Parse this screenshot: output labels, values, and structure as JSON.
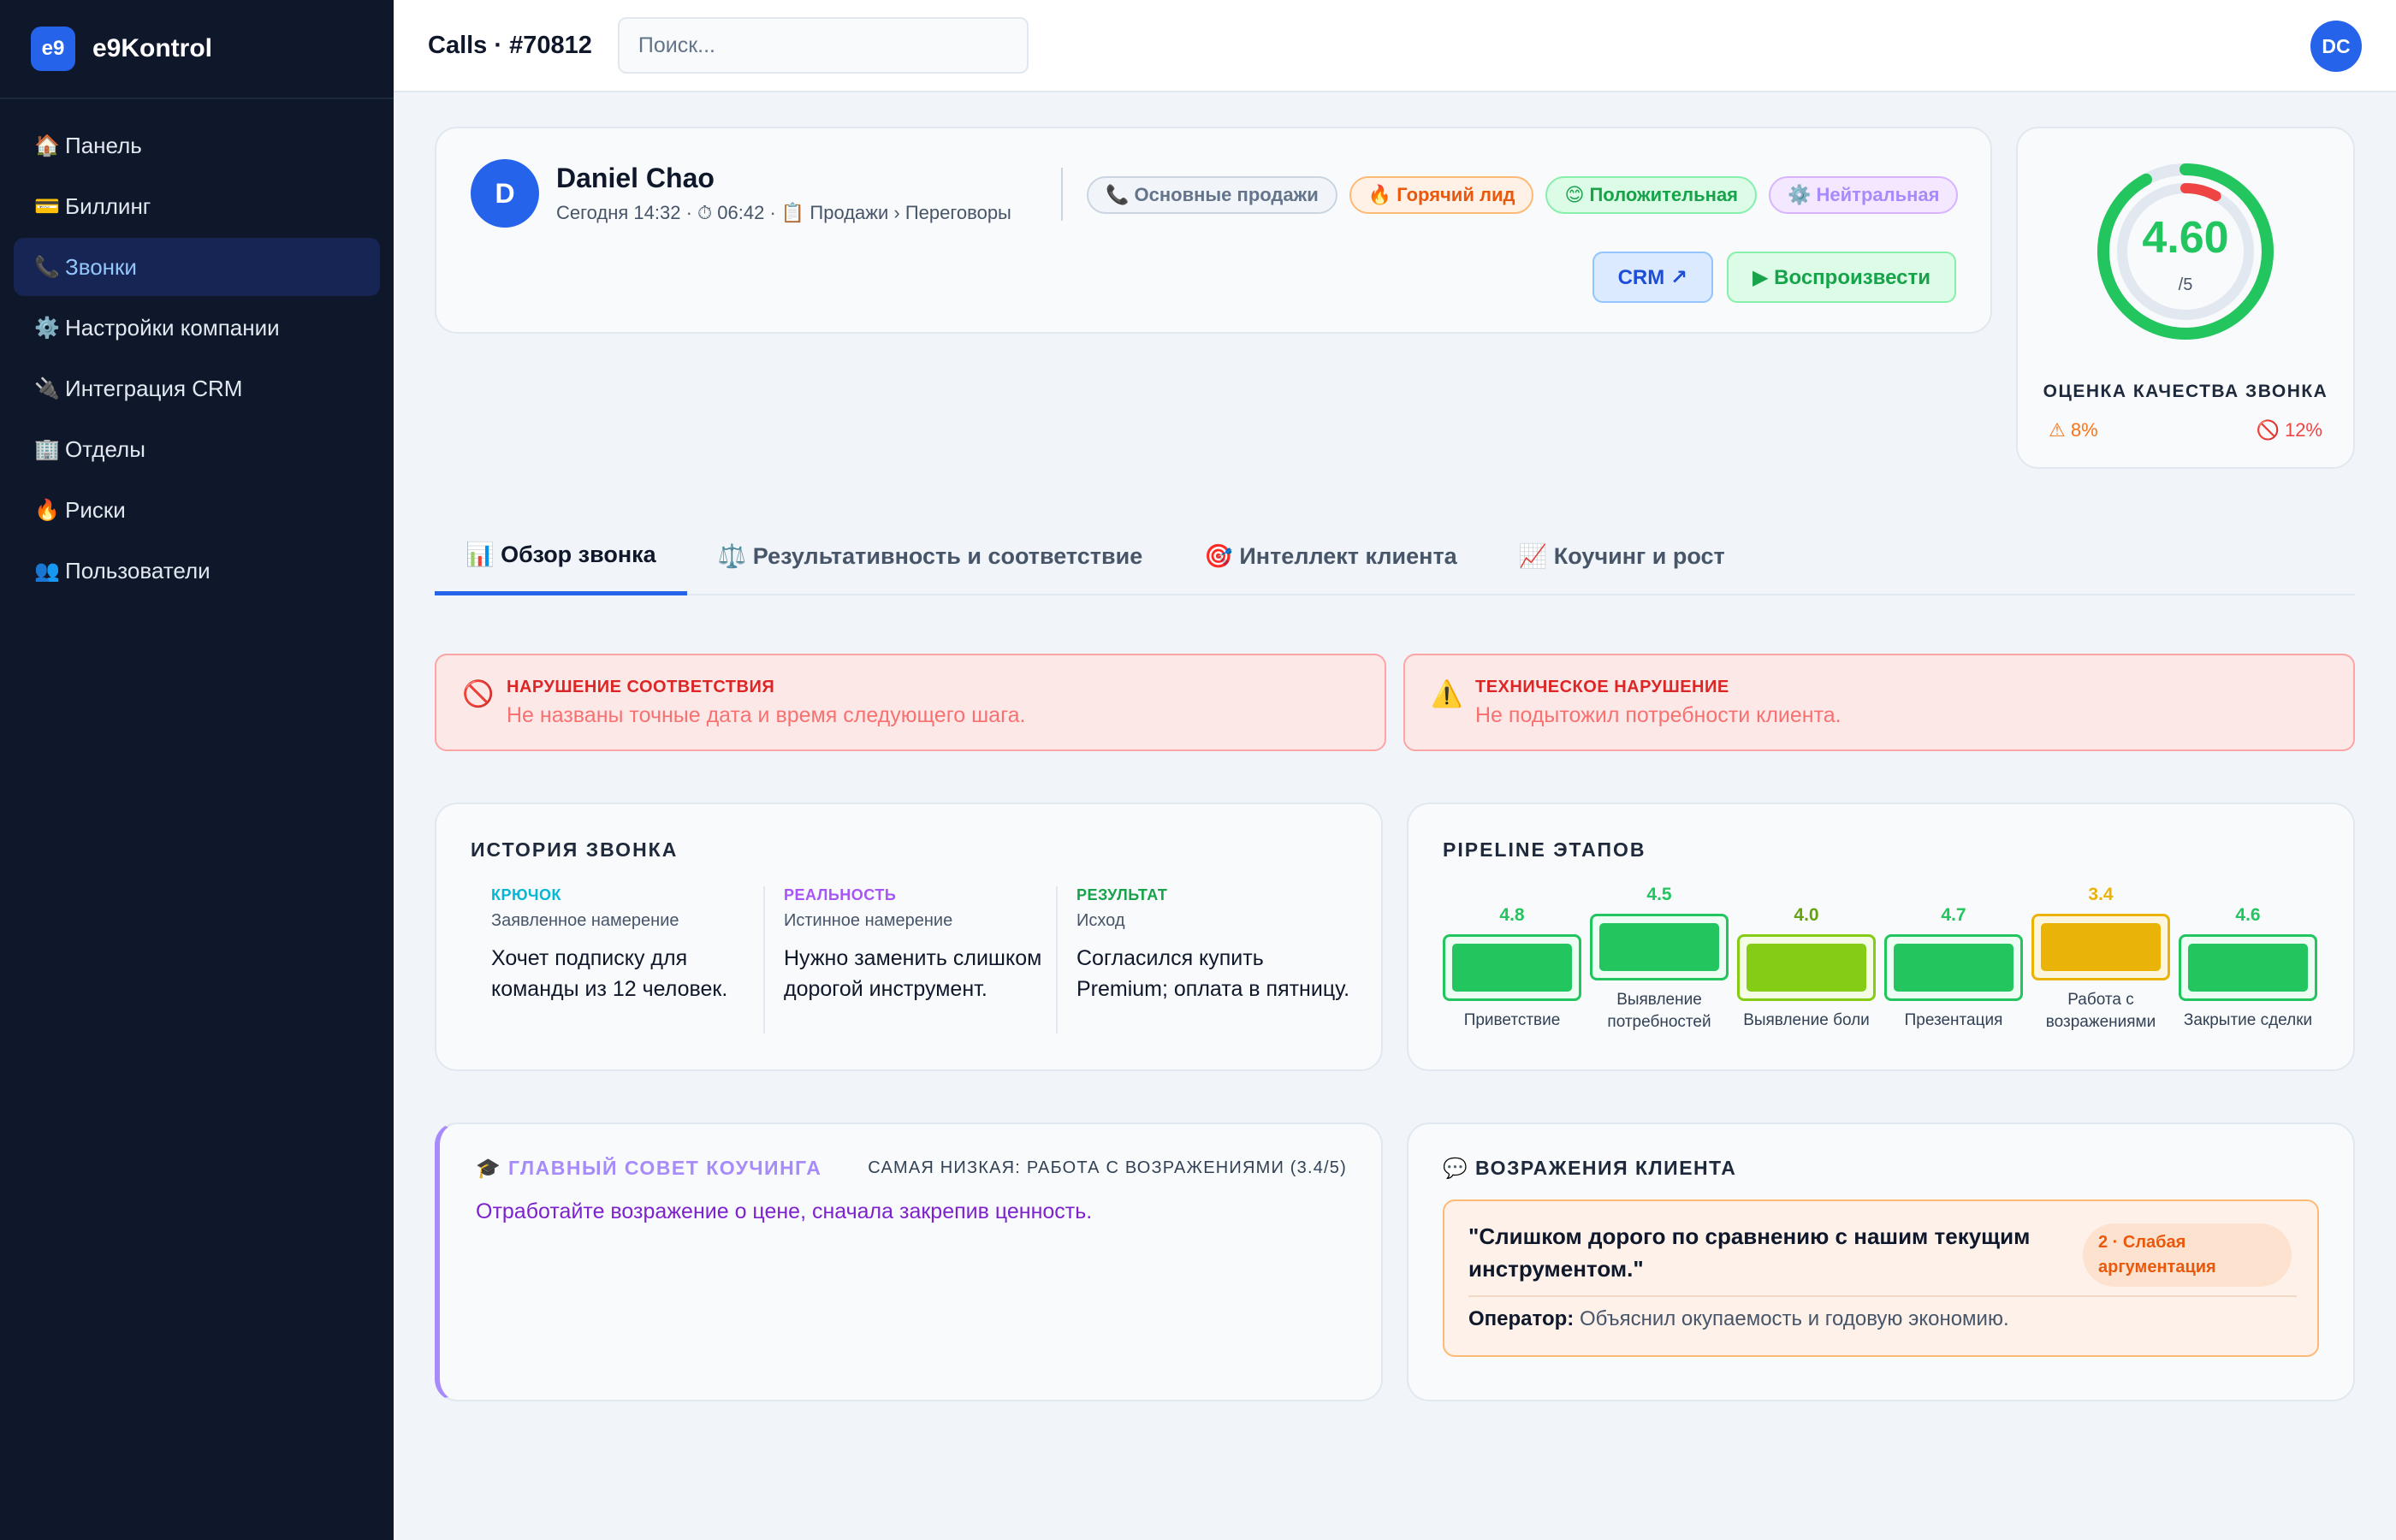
{
  "app": {
    "logo": "e9",
    "name": "e9Kontrol"
  },
  "sidebar": {
    "items": [
      {
        "icon": "🏠",
        "icon_name": "home-icon",
        "label": "Панель",
        "active": false
      },
      {
        "icon": "💳",
        "icon_name": "credit-card-icon",
        "label": "Биллинг",
        "active": false
      },
      {
        "icon": "📞",
        "icon_name": "phone-icon",
        "label": "Звонки",
        "active": true
      },
      {
        "icon": "⚙️",
        "icon_name": "gear-icon",
        "label": "Настройки компании",
        "active": false
      },
      {
        "icon": "🔌",
        "icon_name": "plug-icon",
        "label": "Интеграция CRM",
        "active": false
      },
      {
        "icon": "🏢",
        "icon_name": "building-icon",
        "label": "Отделы",
        "active": false
      },
      {
        "icon": "🔥",
        "icon_name": "fire-icon",
        "label": "Риски",
        "active": false
      },
      {
        "icon": "👥",
        "icon_name": "users-icon",
        "label": "Пользователи",
        "active": false
      }
    ]
  },
  "topbar": {
    "title": "Calls · #70812",
    "search_placeholder": "Поиск...",
    "user_initials": "DC"
  },
  "call": {
    "avatar_letter": "D",
    "name": "Daniel Chao",
    "meta": "Сегодня 14:32 · ⏱ 06:42 · 📋 Продажи › Переговоры",
    "chips": [
      {
        "text": "📞 Основные продажи",
        "style": "gray"
      },
      {
        "text": "🔥 Горячий лид",
        "style": "orange"
      },
      {
        "text": "😊 Положительная",
        "style": "green"
      },
      {
        "text": "⚙️ Нейтральная",
        "style": "purple"
      }
    ],
    "crm_label": "CRM ↗",
    "play_label": "▶ Воспроизвести"
  },
  "score": {
    "value": "4.60",
    "max": "/5",
    "value_num": 4.6,
    "max_num": 5,
    "warn_fraction": 0.08,
    "label": "ОЦЕНКА КАЧЕСТВА ЗВОНКА",
    "warn": "⚠ 8%",
    "block": "🚫 12%",
    "colors": {
      "main": "#22c55e",
      "warn": "#ef4444",
      "track": "#e2e8f0"
    }
  },
  "tabs": [
    {
      "label": "📊 Обзор звонка",
      "active": true
    },
    {
      "label": "⚖️ Результативность и соответствие",
      "active": false
    },
    {
      "label": "🎯 Интеллект клиента",
      "active": false
    },
    {
      "label": "📈 Коучинг и рост",
      "active": false
    }
  ],
  "alerts": [
    {
      "icon": "🚫",
      "title": "НАРУШЕНИЕ СООТВЕТСТВИЯ",
      "text": "Не названы точные дата и время следующего шага."
    },
    {
      "icon": "⚠️",
      "title": "ТЕХНИЧЕСКОЕ НАРУШЕНИЕ",
      "text": "Не подытожил потребности клиента."
    }
  ],
  "story": {
    "title": "ИСТОРИЯ ЗВОНКА",
    "columns": [
      {
        "kind": "КРЮЧОК",
        "sub": "Заявленное намерение",
        "body": "Хочет подписку для команды из 12 человек.",
        "color": "#06b6d4"
      },
      {
        "kind": "РЕАЛЬНОСТЬ",
        "sub": "Истинное намерение",
        "body": "Нужно заменить слишком дорогой инструмент.",
        "color": "#a855f7"
      },
      {
        "kind": "РЕЗУЛЬТАТ",
        "sub": "Исход",
        "body": "Согласился купить Premium; оплата в пятницу.",
        "color": "#16a34a"
      }
    ]
  },
  "pipeline": {
    "title": "PIPELINE ЭТАПОВ",
    "stages": [
      {
        "score": "4.8",
        "label": "Приветствие",
        "label2": "",
        "fill": "#22c55e",
        "border": "#22c55e",
        "bg": "#ecfdf3",
        "text": "#22c55e"
      },
      {
        "score": "4.5",
        "label": "Выявление",
        "label2": "потребностей",
        "fill": "#22c55e",
        "border": "#22c55e",
        "bg": "#ecfdf3",
        "text": "#22c55e"
      },
      {
        "score": "4.0",
        "label": "Выявление боли",
        "label2": "",
        "fill": "#84cc16",
        "border": "#84cc16",
        "bg": "#f4fce6",
        "text": "#65a30d"
      },
      {
        "score": "4.7",
        "label": "Презентация",
        "label2": "",
        "fill": "#22c55e",
        "border": "#22c55e",
        "bg": "#ecfdf3",
        "text": "#22c55e"
      },
      {
        "score": "3.4",
        "label": "Работа с",
        "label2": "возражениями",
        "fill": "#eab308",
        "border": "#eab308",
        "bg": "#fdf6dc",
        "text": "#eab308"
      },
      {
        "score": "4.6",
        "label": "Закрытие сделки",
        "label2": "",
        "fill": "#22c55e",
        "border": "#22c55e",
        "bg": "#ecfdf3",
        "text": "#22c55e"
      }
    ]
  },
  "coaching": {
    "title": "🎓 ГЛАВНЫЙ СОВЕТ КОУЧИНГА",
    "lowest": "САМАЯ НИЗКАЯ: РАБОТА С ВОЗРАЖЕНИЯМИ (3.4/5)",
    "text": "Отработайте возражение о цене, сначала закрепив ценность."
  },
  "objections": {
    "title": "💬 ВОЗРАЖЕНИЯ КЛИЕНТА",
    "quote": "\"Слишком дорого по сравнению с нашим текущим инструментом.\"",
    "badge_line1": "2 · Слабая",
    "badge_line2": "аргументация",
    "answer_label": "Оператор:",
    "answer_text": " Объяснил окупаемость и годовую экономию."
  }
}
